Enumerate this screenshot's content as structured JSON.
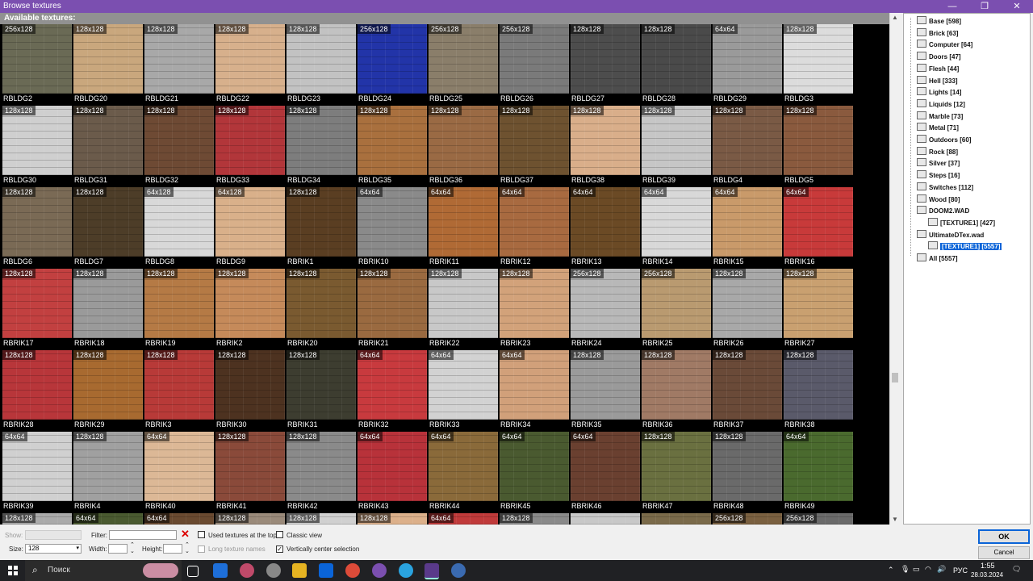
{
  "window": {
    "title": "Browse textures",
    "min": "—",
    "restore": "❐",
    "close": "✕"
  },
  "gallery": {
    "header": "Available textures:",
    "rows": [
      [
        {
          "n": "RBLDG2",
          "s": "256x128",
          "c": "#6a6a55"
        },
        {
          "n": "RBLDG20",
          "s": "128x128",
          "c": "#c9a77d"
        },
        {
          "n": "RBLDG21",
          "s": "128x128",
          "c": "#a8a8a8"
        },
        {
          "n": "RBLDG22",
          "s": "128x128",
          "c": "#d7b08c"
        },
        {
          "n": "RBLDG23",
          "s": "128x128",
          "c": "#c2c2c2"
        },
        {
          "n": "RBLDG24",
          "s": "256x128",
          "c": "#2234a8"
        },
        {
          "n": "RBLDG25",
          "s": "256x128",
          "c": "#8a7e6a"
        },
        {
          "n": "RBLDG26",
          "s": "256x128",
          "c": "#7a7a7a"
        },
        {
          "n": "RBLDG27",
          "s": "128x128",
          "c": "#4d4d4d"
        },
        {
          "n": "RBLDG28",
          "s": "128x128",
          "c": "#4a4a4a"
        },
        {
          "n": "RBLDG29",
          "s": "64x64",
          "c": "#9a9a9a"
        },
        {
          "n": "RBLDG3",
          "s": "128x128",
          "c": "#dcdcdc"
        }
      ],
      [
        {
          "n": "RBLDG30",
          "s": "128x128",
          "c": "#cfcfcf"
        },
        {
          "n": "RBLDG31",
          "s": "128x128",
          "c": "#6b5b4b"
        },
        {
          "n": "RBLDG32",
          "s": "128x128",
          "c": "#6e4a34"
        },
        {
          "n": "RBLDG33",
          "s": "128x128",
          "c": "#b2363a"
        },
        {
          "n": "RBLDG34",
          "s": "128x128",
          "c": "#7d7d7d"
        },
        {
          "n": "RBLDG35",
          "s": "128x128",
          "c": "#a9703e"
        },
        {
          "n": "RBLDG36",
          "s": "128x128",
          "c": "#9a6a44"
        },
        {
          "n": "RBLDG37",
          "s": "128x128",
          "c": "#6e5230"
        },
        {
          "n": "RBLDG38",
          "s": "128x128",
          "c": "#d9ae8a"
        },
        {
          "n": "RBLDG39",
          "s": "128x128",
          "c": "#c6c6c6"
        },
        {
          "n": "RBLDG4",
          "s": "128x128",
          "c": "#7a5a45"
        },
        {
          "n": "RBLDG5",
          "s": "128x128",
          "c": "#8a5a3e"
        }
      ],
      [
        {
          "n": "RBLDG6",
          "s": "128x128",
          "c": "#7a6a55"
        },
        {
          "n": "RBLDG7",
          "s": "128x128",
          "c": "#4d3d28"
        },
        {
          "n": "RBLDG8",
          "s": "64x128",
          "c": "#d8d8d8"
        },
        {
          "n": "RBLDG9",
          "s": "64x128",
          "c": "#d9b08a"
        },
        {
          "n": "RBRIK1",
          "s": "128x128",
          "c": "#5a3e22"
        },
        {
          "n": "RBRIK10",
          "s": "64x64",
          "c": "#8a8a8a"
        },
        {
          "n": "RBRIK11",
          "s": "64x64",
          "c": "#b06a35"
        },
        {
          "n": "RBRIK12",
          "s": "64x64",
          "c": "#a86a40"
        },
        {
          "n": "RBRIK13",
          "s": "64x64",
          "c": "#6b4a25"
        },
        {
          "n": "RBRIK14",
          "s": "64x64",
          "c": "#d8d8d8"
        },
        {
          "n": "RBRIK15",
          "s": "64x64",
          "c": "#c99a6a"
        },
        {
          "n": "RBRIK16",
          "s": "64x64",
          "c": "#c83a3a"
        }
      ],
      [
        {
          "n": "RBRIK17",
          "s": "128x128",
          "c": "#c24040"
        },
        {
          "n": "RBRIK18",
          "s": "128x128",
          "c": "#9a9a9a"
        },
        {
          "n": "RBRIK19",
          "s": "128x128",
          "c": "#b57a45"
        },
        {
          "n": "RBRIK2",
          "s": "128x128",
          "c": "#c58a5a"
        },
        {
          "n": "RBRIK20",
          "s": "128x128",
          "c": "#7a5a30"
        },
        {
          "n": "RBRIK21",
          "s": "128x128",
          "c": "#9a6a40"
        },
        {
          "n": "RBRIK22",
          "s": "128x128",
          "c": "#c8c8c8"
        },
        {
          "n": "RBRIK23",
          "s": "128x128",
          "c": "#d2a27a"
        },
        {
          "n": "RBRIK24",
          "s": "256x128",
          "c": "#b8b8b8"
        },
        {
          "n": "RBRIK25",
          "s": "256x128",
          "c": "#b99a70"
        },
        {
          "n": "RBRIK26",
          "s": "128x128",
          "c": "#a8a8a8"
        },
        {
          "n": "RBRIK27",
          "s": "128x128",
          "c": "#c9a070"
        }
      ],
      [
        {
          "n": "RBRIK28",
          "s": "128x128",
          "c": "#b8363a"
        },
        {
          "n": "RBRIK29",
          "s": "128x128",
          "c": "#a86a30"
        },
        {
          "n": "RBRIK3",
          "s": "128x128",
          "c": "#b83a38"
        },
        {
          "n": "RBRIK30",
          "s": "128x128",
          "c": "#4d3220"
        },
        {
          "n": "RBRIK31",
          "s": "128x128",
          "c": "#3d3d30"
        },
        {
          "n": "RBRIK32",
          "s": "64x64",
          "c": "#c83a3e"
        },
        {
          "n": "RBRIK33",
          "s": "64x64",
          "c": "#d2d2d2"
        },
        {
          "n": "RBRIK34",
          "s": "64x64",
          "c": "#d1a07a"
        },
        {
          "n": "RBRIK35",
          "s": "128x128",
          "c": "#9a9a9a"
        },
        {
          "n": "RBRIK36",
          "s": "128x128",
          "c": "#a07a65"
        },
        {
          "n": "RBRIK37",
          "s": "128x128",
          "c": "#6a4a38"
        },
        {
          "n": "RBRIK38",
          "s": "128x128",
          "c": "#5a5a6a"
        }
      ],
      [
        {
          "n": "RBRIK39",
          "s": "64x64",
          "c": "#d0d0d0"
        },
        {
          "n": "RBRIK4",
          "s": "128x128",
          "c": "#a0a0a0"
        },
        {
          "n": "RBRIK40",
          "s": "64x64",
          "c": "#dcb896"
        },
        {
          "n": "RBRIK41",
          "s": "128x128",
          "c": "#8a4a3a"
        },
        {
          "n": "RBRIK42",
          "s": "128x128",
          "c": "#8a8a8a"
        },
        {
          "n": "RBRIK43",
          "s": "64x64",
          "c": "#b8323a"
        },
        {
          "n": "RBRIK44",
          "s": "64x64",
          "c": "#8a6a3a"
        },
        {
          "n": "RBRIK45",
          "s": "64x64",
          "c": "#4a5a30"
        },
        {
          "n": "RBRIK46",
          "s": "64x64",
          "c": "#6a4030"
        },
        {
          "n": "RBRIK47",
          "s": "128x128",
          "c": "#6a7040"
        },
        {
          "n": "RBRIK48",
          "s": "128x128",
          "c": "#6a6a6a"
        },
        {
          "n": "RBRIK49",
          "s": "64x64",
          "c": "#4a6a2e"
        }
      ],
      [
        {
          "n": "",
          "s": "128x128",
          "c": "#aaaaaa"
        },
        {
          "n": "",
          "s": "64x64",
          "c": "#4a5a30"
        },
        {
          "n": "",
          "s": "64x64",
          "c": "#6a4a30"
        },
        {
          "n": "",
          "s": "128x128",
          "c": "#9a8a7a"
        },
        {
          "n": "",
          "s": "128x128",
          "c": "#d0d0d0"
        },
        {
          "n": "",
          "s": "128x128",
          "c": "#dcb08a"
        },
        {
          "n": "",
          "s": "64x64",
          "c": "#c03a3a"
        },
        {
          "n": "",
          "s": "128x128",
          "c": "#8a8a8a"
        },
        {
          "n": "",
          "s": "",
          "c": "#c8c8c8"
        },
        {
          "n": "",
          "s": "",
          "c": "#7a6a4a"
        },
        {
          "n": "",
          "s": "256x128",
          "c": "#7a6040"
        },
        {
          "n": "",
          "s": "256x128",
          "c": "#6a6a6a"
        }
      ]
    ]
  },
  "tree": {
    "items": [
      {
        "label": "Base [598]",
        "level": 1
      },
      {
        "label": "Brick [63]",
        "level": 1
      },
      {
        "label": "Computer [64]",
        "level": 1
      },
      {
        "label": "Doors [47]",
        "level": 1
      },
      {
        "label": "Flesh [44]",
        "level": 1
      },
      {
        "label": "Hell [333]",
        "level": 1
      },
      {
        "label": "Lights [14]",
        "level": 1
      },
      {
        "label": "Liquids [12]",
        "level": 1
      },
      {
        "label": "Marble [73]",
        "level": 1
      },
      {
        "label": "Metal [71]",
        "level": 1
      },
      {
        "label": "Outdoors [60]",
        "level": 1
      },
      {
        "label": "Rock [88]",
        "level": 1
      },
      {
        "label": "Silver [37]",
        "level": 1
      },
      {
        "label": "Steps [16]",
        "level": 1
      },
      {
        "label": "Switches [112]",
        "level": 1
      },
      {
        "label": "Wood [80]",
        "level": 1
      },
      {
        "label": "DOOM2.WAD",
        "level": 1
      },
      {
        "label": "[TEXTURE1] [427]",
        "level": 2
      },
      {
        "label": "UltimateDTex.wad",
        "level": 1
      },
      {
        "label": "[TEXTURE1] [5557]",
        "level": 2,
        "selected": true
      },
      {
        "label": "All [5557]",
        "level": 1
      }
    ]
  },
  "bottom": {
    "show_label": "Show:",
    "filter_label": "Filter:",
    "used_top": "Used textures at the top",
    "classic": "Classic view",
    "size_label": "Size:",
    "size_value": "128",
    "width_label": "Width:",
    "height_label": "Height:",
    "long_names": "Long texture names",
    "vcenter": "Vertically center selection",
    "ok": "OK",
    "cancel": "Cancel"
  },
  "taskbar": {
    "search_placeholder": "Поиск",
    "lang": "РУС",
    "time": "1:55",
    "date": "28.03.2024"
  }
}
